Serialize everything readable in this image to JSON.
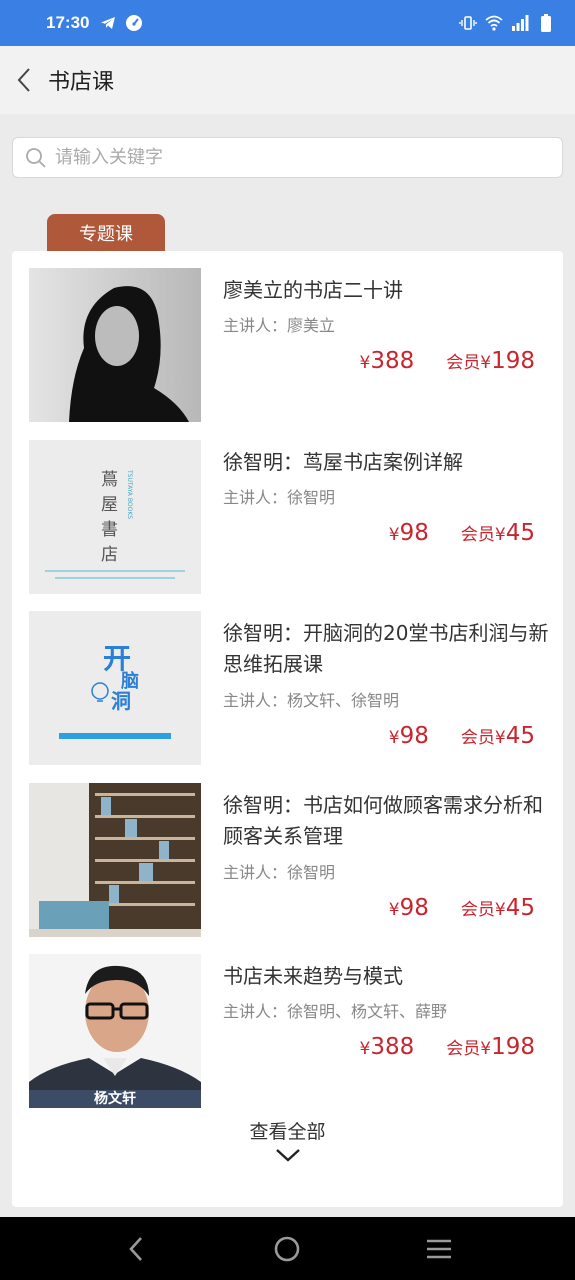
{
  "status_bar": {
    "time": "17:30"
  },
  "header": {
    "title": "书店课"
  },
  "search": {
    "placeholder": "请输入关键字"
  },
  "section_tab": {
    "label": "专题课"
  },
  "lecturer_prefix": "主讲人：",
  "courses": [
    {
      "title": "廖美立的书店二十讲",
      "lecturer": "廖美立",
      "price": "388",
      "member_label": "会员¥",
      "member_price": "198"
    },
    {
      "title": "徐智明：茑屋书店案例详解",
      "lecturer": "徐智明",
      "price": "98",
      "member_label": "会员¥",
      "member_price": "45",
      "thumb_text": {
        "line1": "蔦",
        "line2": "屋",
        "line3": "書",
        "line4": "店",
        "side": "TSUTAYA BOOKS"
      }
    },
    {
      "title": "徐智明：开脑洞的20堂书店利润与新思维拓展课",
      "lecturer": "杨文轩、徐智明",
      "price": "98",
      "member_label": "会员¥",
      "member_price": "45",
      "thumb_text": {
        "a": "开",
        "b": "脑",
        "c": "洞"
      }
    },
    {
      "title": "徐智明：书店如何做顾客需求分析和顾客关系管理",
      "lecturer": "徐智明",
      "price": "98",
      "member_label": "会员¥",
      "member_price": "45"
    },
    {
      "title": "书店未来趋势与模式",
      "lecturer": "徐智明、杨文轩、薛野",
      "price": "388",
      "member_label": "会员¥",
      "member_price": "198",
      "thumb_caption": "杨文轩"
    }
  ],
  "currency": "¥",
  "view_all": {
    "label": "查看全部"
  },
  "colors": {
    "status_bar": "#3a7fe3",
    "price": "#c8262f",
    "tab": "#b0583a"
  },
  "icons": {
    "back": "chevron-left-icon",
    "search": "search-icon",
    "expand": "chevron-down-icon"
  }
}
